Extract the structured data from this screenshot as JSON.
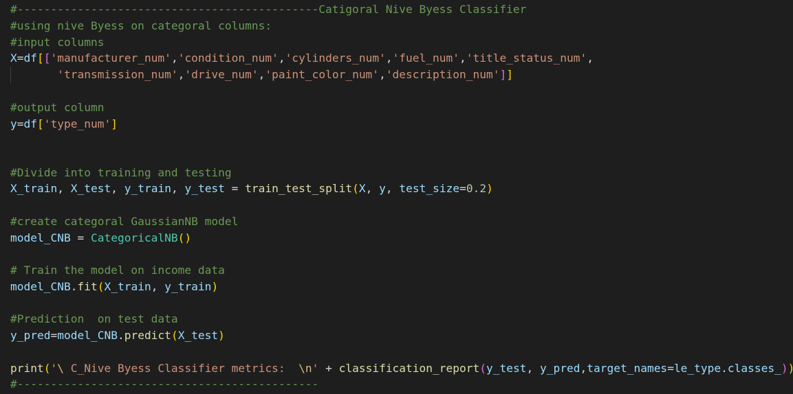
{
  "colors": {
    "background": "#1e1e1e",
    "comment": "#6a9955",
    "variable": "#9cdcfe",
    "string": "#ce9178",
    "function": "#dcdcaa",
    "class": "#4ec9b0",
    "number": "#b5cea8",
    "bracket_gold": "#ffd700",
    "bracket_purple": "#da70d6",
    "bracket_blue": "#179fff"
  },
  "code": {
    "l1": "#---------------------------------------------Catigoral Nive Byess Classifier",
    "l2": "#using nive Byess on categoral columns:",
    "l3": "#input columns",
    "l4": {
      "X": "X",
      "eq": "=",
      "df": "df",
      "s1": "'manufacturer_num'",
      "s2": "'condition_num'",
      "s3": "'cylinders_num'",
      "s4": "'fuel_num'",
      "s5": "'title_status_num'"
    },
    "l5": {
      "s6": "'transmission_num'",
      "s7": "'drive_num'",
      "s8": "'paint_color_num'",
      "s9": "'description_num'"
    },
    "l7": "#output column",
    "l8": {
      "y": "y",
      "df": "df",
      "s": "'type_num'"
    },
    "l11": "#Divide into training and testing",
    "l12": {
      "X_train": "X_train",
      "X_test": "X_test",
      "y_train": "y_train",
      "y_test": "y_test",
      "fn": "train_test_split",
      "X": "X",
      "y": "y",
      "test_size": "test_size",
      "num": "0.2"
    },
    "l14": "#create categoral GaussianNB model",
    "l15": {
      "var": "model_CNB",
      "cls": "CategoricalNB"
    },
    "l17": "# Train the model on income data",
    "l18": {
      "var": "model_CNB",
      "fn": "fit",
      "a1": "X_train",
      "a2": "y_train"
    },
    "l20": "#Prediction  on test data",
    "l21": {
      "y_pred": "y_pred",
      "var": "model_CNB",
      "fn": "predict",
      "a1": "X_test"
    },
    "l23": {
      "fn": "print",
      "s_open": "'",
      "esc": "\\ ",
      "s_mid": "C_Nive Byess Classifier metrics:  ",
      "nl": "\\n",
      "s_close": "'",
      "fn2": "classification_report",
      "a1": "y_test",
      "a2": "y_pred",
      "kw": "target_names",
      "le": "le_type",
      "attr": "classes_"
    },
    "l24": "#---------------------------------------------"
  }
}
